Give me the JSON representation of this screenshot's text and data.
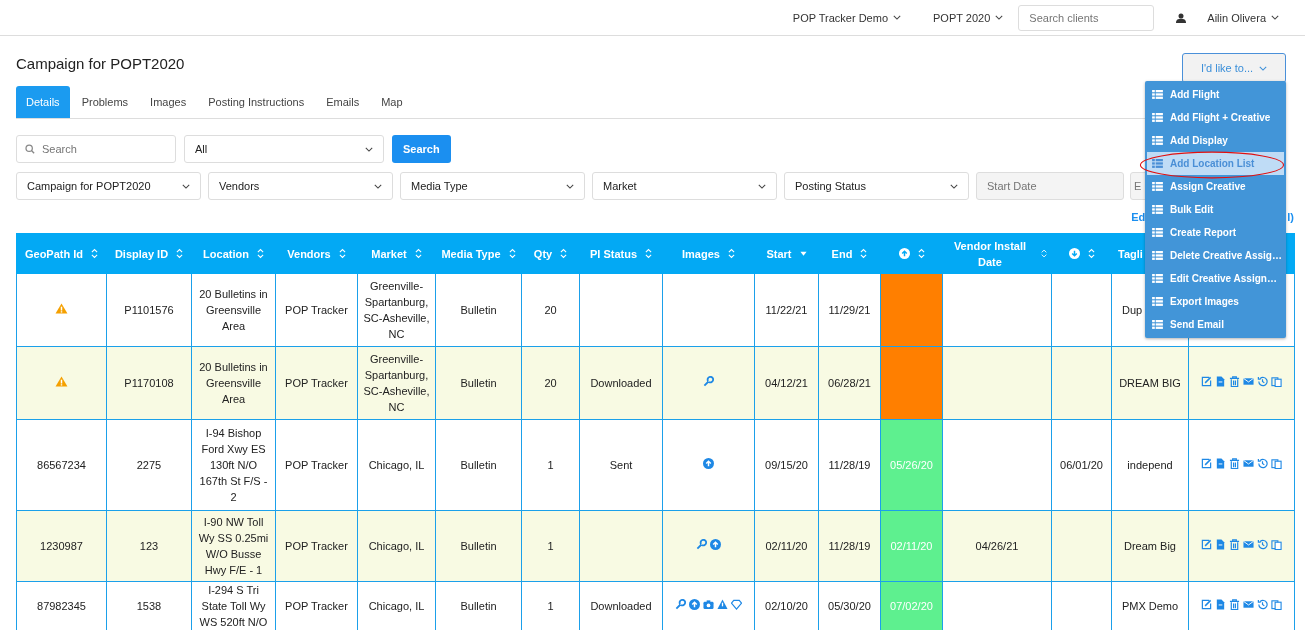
{
  "topbar": {
    "menus": [
      "POP Tracker Demo",
      "POPT 2020"
    ],
    "search": {
      "placeholder": "Search clients"
    },
    "user": "Ailin Olivera"
  },
  "title": "Campaign for POPT2020",
  "action_button": "I'd like to...",
  "tabs": [
    {
      "label": "Details",
      "selected": true
    },
    {
      "label": "Problems",
      "selected": false
    },
    {
      "label": "Images",
      "selected": false
    },
    {
      "label": "Posting Instructions",
      "selected": false
    },
    {
      "label": "Emails",
      "selected": false
    },
    {
      "label": "Map",
      "selected": false
    }
  ],
  "search": {
    "placeholder": "Search",
    "scope": "All",
    "button": "Search"
  },
  "filters": [
    {
      "kind": "select",
      "label": "Campaign for POPT2020"
    },
    {
      "kind": "select",
      "label": "Vendors"
    },
    {
      "kind": "select",
      "label": "Media Type"
    },
    {
      "kind": "select",
      "label": "Market"
    },
    {
      "kind": "select",
      "label": "Posting Status"
    },
    {
      "kind": "date",
      "placeholder": "Start Date"
    },
    {
      "kind": "date",
      "placeholder": "E"
    }
  ],
  "link_fragments": [
    "Ed",
    "l)"
  ],
  "table": {
    "columns": [
      {
        "kind": "text",
        "label": "GeoPath Id",
        "sortable": true,
        "sorted": false
      },
      {
        "kind": "text",
        "label": "Display ID",
        "sortable": true,
        "sorted": false
      },
      {
        "kind": "text",
        "label": "Location",
        "sortable": true,
        "sorted": false
      },
      {
        "kind": "text",
        "label": "Vendors",
        "sortable": true,
        "sorted": false
      },
      {
        "kind": "text",
        "label": "Market",
        "sortable": true,
        "sorted": false
      },
      {
        "kind": "text",
        "label": "Media Type",
        "sortable": true,
        "sorted": false
      },
      {
        "kind": "text",
        "label": "Qty",
        "sortable": true,
        "sorted": false
      },
      {
        "kind": "text",
        "label": "PI Status",
        "sortable": true,
        "sorted": false
      },
      {
        "kind": "text",
        "label": "Images",
        "sortable": true,
        "sorted": false
      },
      {
        "kind": "text",
        "label": "Start",
        "sortable": true,
        "sorted": true
      },
      {
        "kind": "text",
        "label": "End",
        "sortable": true,
        "sorted": false
      },
      {
        "kind": "upload",
        "sortable": true,
        "sorted": false
      },
      {
        "kind": "text",
        "label": "Vendor Install Date",
        "sortable": true,
        "sorted": false
      },
      {
        "kind": "download",
        "sortable": true,
        "sorted": false
      },
      {
        "kind": "text",
        "label": "Tagli",
        "sortable": false
      },
      {
        "kind": "blank",
        "sortable": false
      }
    ],
    "rows": [
      {
        "warning": true,
        "display_id": "P1101576",
        "location": "20 Bulletins in Greensville Area",
        "vendor": "POP Tracker",
        "market": "Greenville-Spartanburg, SC-Asheville, NC",
        "media_type": "Bulletin",
        "qty": "20",
        "pi_status": "",
        "images": [],
        "start": "11/22/21",
        "end": "11/29/21",
        "color": "#ff7f00",
        "status_date": "",
        "install_date": "",
        "download_date": "",
        "tagline": "Dup",
        "actions": false
      },
      {
        "warning": true,
        "display_id": "P1170108",
        "location": "20 Bulletins in Greensville Area",
        "vendor": "POP Tracker",
        "market": "Greenville-Spartanburg, SC-Asheville, NC",
        "media_type": "Bulletin",
        "qty": "20",
        "pi_status": "Downloaded",
        "images": [
          {
            "kind": "wrench"
          }
        ],
        "start": "04/12/21",
        "end": "06/28/21",
        "color": "#ff7f00",
        "status_date": "",
        "install_date": "",
        "download_date": "",
        "tagline": "DREAM BIG",
        "actions": true
      },
      {
        "warning": false,
        "geopath_id": "86567234",
        "display_id": "2275",
        "location": "I-94 Bishop Ford Xwy ES 130ft N/O 167th St F/S - 2",
        "vendor": "POP Tracker",
        "market": "Chicago, IL",
        "media_type": "Bulletin",
        "qty": "1",
        "pi_status": "Sent",
        "images": [
          {
            "kind": "upload"
          }
        ],
        "start": "09/15/20",
        "end": "11/28/19",
        "color": "#5ef08f",
        "status_date": "05/26/20",
        "install_date": "",
        "download_date": "06/01/20",
        "tagline": "independ",
        "actions": true
      },
      {
        "warning": false,
        "geopath_id": "1230987",
        "display_id": "123",
        "location": "I-90 NW Toll Wy SS 0.25mi W/O Busse Hwy F/E - 1",
        "vendor": "POP Tracker",
        "market": "Chicago, IL",
        "media_type": "Bulletin",
        "qty": "1",
        "pi_status": "",
        "images": [
          {
            "kind": "wrench"
          },
          {
            "kind": "upload"
          }
        ],
        "start": "02/11/20",
        "end": "11/28/19",
        "color": "#5ef08f",
        "status_date": "02/11/20",
        "install_date": "04/26/21",
        "download_date": "",
        "tagline": "Dream Big",
        "actions": true
      },
      {
        "warning": false,
        "geopath_id": "87982345",
        "display_id": "1538",
        "location": "I-294 S Tri State Toll Wy WS 520ft N/O",
        "vendor": "POP Tracker",
        "market": "Chicago, IL",
        "media_type": "Bulletin",
        "qty": "1",
        "pi_status": "Downloaded",
        "images": [
          {
            "kind": "wrench"
          },
          {
            "kind": "upload"
          },
          {
            "kind": "camera"
          },
          {
            "kind": "warning"
          },
          {
            "kind": "diamond"
          }
        ],
        "start": "02/10/20",
        "end": "05/30/20",
        "color": "#5ef08f",
        "status_date": "07/02/20",
        "install_date": "",
        "download_date": "",
        "tagline": "PMX Demo",
        "actions": true
      }
    ]
  },
  "menu": {
    "items": [
      {
        "label": "Add Flight",
        "selected": false
      },
      {
        "label": "Add Flight + Creative",
        "selected": false
      },
      {
        "label": "Add Display",
        "selected": false
      },
      {
        "label": "Add Location List",
        "selected": true
      },
      {
        "label": "Assign Creative",
        "selected": false
      },
      {
        "label": "Bulk Edit",
        "selected": false
      },
      {
        "label": "Create Report",
        "selected": false
      },
      {
        "label": "Delete Creative Assig…",
        "selected": false
      },
      {
        "label": "Edit Creative Assign…",
        "selected": false
      },
      {
        "label": "Export Images",
        "selected": false
      },
      {
        "label": "Send Email",
        "selected": false
      }
    ],
    "circled": true
  }
}
